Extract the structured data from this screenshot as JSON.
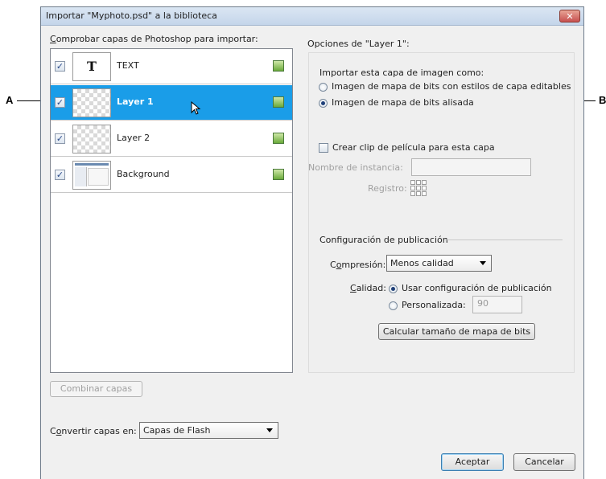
{
  "callouts": {
    "left": "A",
    "right": "B"
  },
  "dialog": {
    "title": "Importar \"Myphoto.psd\" a la biblioteca",
    "close_icon": "close-icon",
    "layers_heading": "Comprobar capas de Photoshop para importar:",
    "layers": [
      {
        "name": "TEXT",
        "checked": true,
        "thumbnail": "T",
        "selected": false
      },
      {
        "name": "Layer 1",
        "checked": true,
        "selected": true
      },
      {
        "name": "Layer 2",
        "checked": true,
        "selected": false
      },
      {
        "name": "Background",
        "checked": true,
        "selected": false
      }
    ],
    "combine_button": "Combinar capas",
    "convert_label": "Convertir capas en:",
    "convert_value": "Capas de Flash",
    "options_heading": "Opciones de \"Layer 1\":",
    "import_as_label": "Importar esta capa de imagen como:",
    "import_options": [
      "Imagen de mapa de bits con estilos de capa editables",
      "Imagen de mapa de bits alisada"
    ],
    "import_selected": 1,
    "movieclip_label": "Crear clip de película para esta capa",
    "movieclip_checked": false,
    "instance_label": "Nombre de instancia:",
    "registration_label": "Registro:",
    "publish_heading": "Configuración de publicación",
    "compression_label": "Compresión:",
    "compression_value": "Menos calidad",
    "quality_label": "Calidad:",
    "quality_options": [
      "Usar configuración de publicación",
      "Personalizada:"
    ],
    "quality_selected": 0,
    "quality_custom_value": "90",
    "calc_button": "Calcular tamaño de mapa de bits",
    "ok_button": "Aceptar",
    "cancel_button": "Cancelar"
  },
  "colors": {
    "selection": "#1a9de8",
    "accent_border": "#3c7fb1"
  }
}
